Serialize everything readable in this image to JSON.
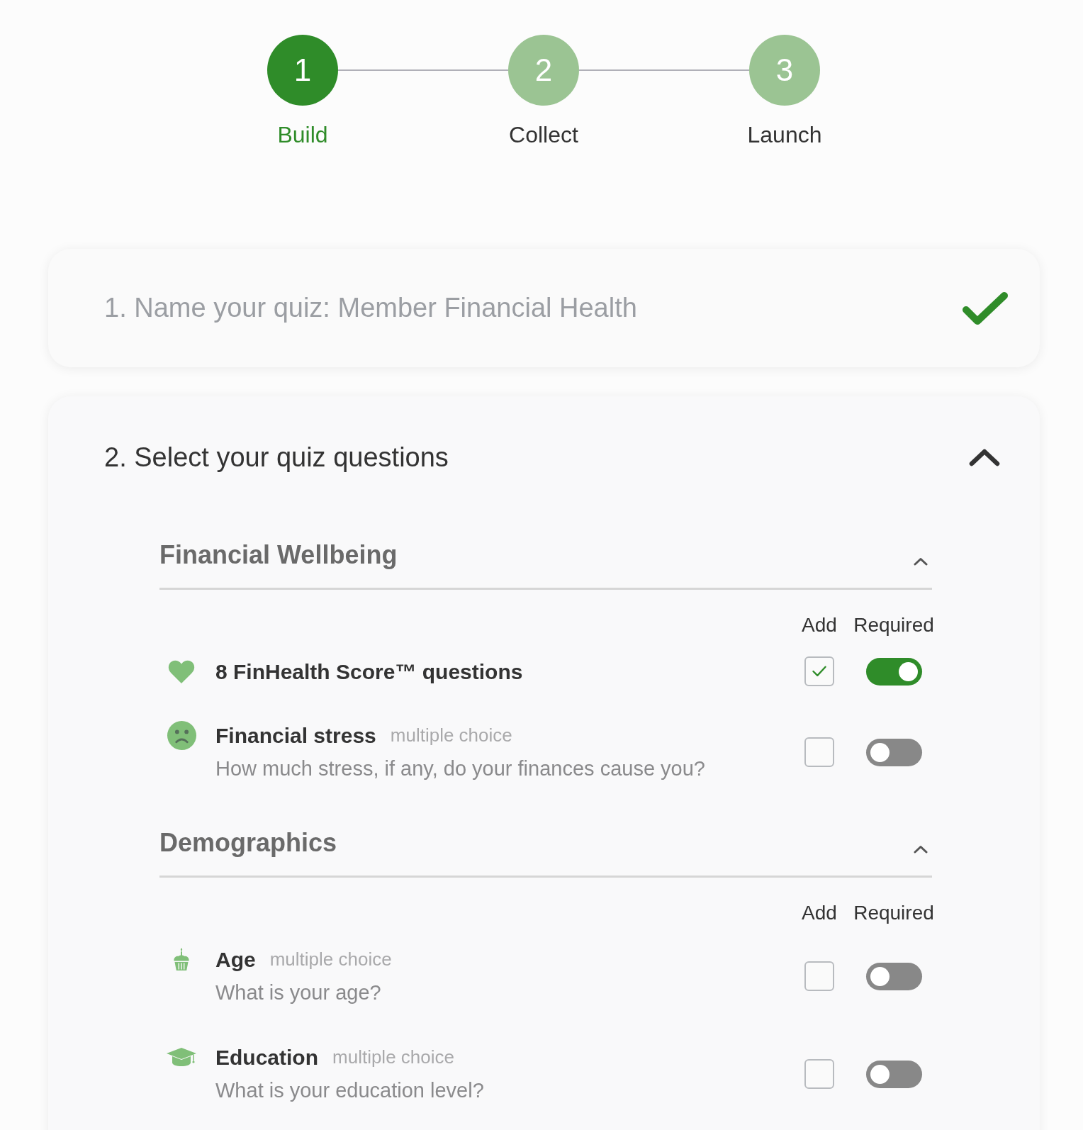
{
  "stepper": {
    "steps": [
      {
        "number": "1",
        "label": "Build",
        "selected": true
      },
      {
        "number": "2",
        "label": "Collect",
        "selected": false
      },
      {
        "number": "3",
        "label": "Launch",
        "selected": false
      }
    ]
  },
  "name_step": {
    "title": "1. Name your quiz: Member Financial Health",
    "completed": true
  },
  "questions_step": {
    "title": "2. Select your quiz questions",
    "expanded": true,
    "sections": [
      {
        "title": "Financial Wellbeing",
        "expanded": true,
        "columns": [
          "Add",
          "Required"
        ],
        "questions": [
          {
            "title": "8 FinHealth Score™ questions",
            "added": true,
            "required": true
          },
          {
            "title": "Financial stress",
            "type": "multiple choice",
            "prompt": "How much stress, if any, do your finances cause you?",
            "added": false,
            "required": false
          }
        ]
      },
      {
        "title": "Demographics",
        "expanded": true,
        "columns": [
          "Add",
          "Required"
        ],
        "questions": [
          {
            "title": "Age",
            "type": "multiple choice",
            "prompt": "What is your age?",
            "added": false,
            "required": false
          },
          {
            "title": "Education",
            "type": "multiple choice",
            "prompt": "What is your education level?",
            "added": false,
            "required": false
          }
        ]
      }
    ]
  }
}
